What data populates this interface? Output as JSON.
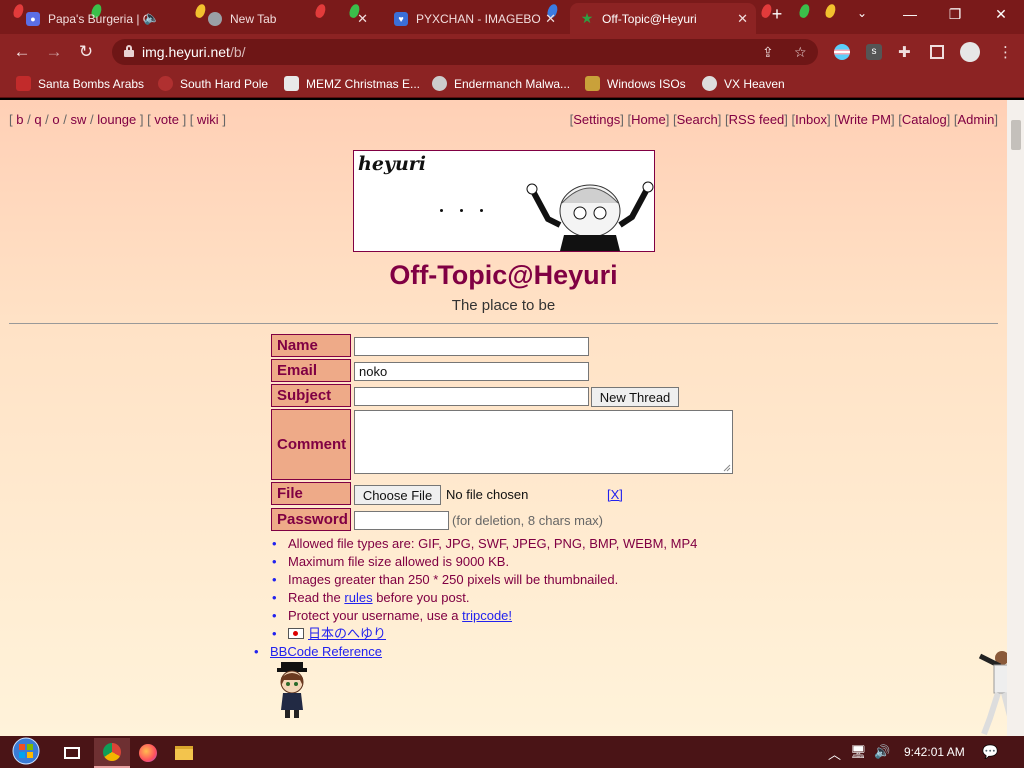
{
  "browser": {
    "tabs": [
      {
        "title": "Papa's Burgeria | C",
        "favicon_color": "#5b6ee6"
      },
      {
        "title": "New Tab",
        "favicon_color": "#9aa0a6"
      },
      {
        "title": "PYXCHAN - IMAGEBO",
        "favicon_color": "#3b6fd8"
      },
      {
        "title": "Off-Topic@Heyuri",
        "favicon_color": "#2ea043",
        "active": true
      }
    ],
    "url_host": "img.heyuri.net",
    "url_path": "/b/",
    "bookmarks": [
      {
        "label": "Santa Bombs Arabs",
        "icon_color": "#c22b2b"
      },
      {
        "label": "South Hard Pole",
        "icon_color": "#b03030"
      },
      {
        "label": "MEMZ Christmas E...",
        "icon_color": "#e8e8e8"
      },
      {
        "label": "Endermanch Malwa...",
        "icon_color": "#cccccc"
      },
      {
        "label": "Windows ISOs",
        "icon_color": "#c9a13a"
      },
      {
        "label": "VX Heaven",
        "icon_color": "#dddddd"
      }
    ]
  },
  "page": {
    "board_nav": {
      "open": "[",
      "items": [
        "b",
        "q",
        "o",
        "sw",
        "lounge"
      ],
      "mid": "] [",
      "vote": "vote",
      "wiki": "wiki",
      "close": "]"
    },
    "top_nav": [
      "Settings",
      "Home",
      "Search",
      "RSS feed",
      "Inbox",
      "Write PM",
      "Catalog",
      "Admin"
    ],
    "banner_text": "heyuri",
    "board_title": "Off-Topic@Heyuri",
    "board_subtitle": "The place to be",
    "form": {
      "name_label": "Name",
      "email_label": "Email",
      "email_value": "noko",
      "subject_label": "Subject",
      "submit_label": "New Thread",
      "comment_label": "Comment",
      "file_label": "File",
      "choose_file_label": "Choose File",
      "no_file_text": "No file chosen",
      "remove_file_label": "[X]",
      "password_label": "Password",
      "password_note": "(for deletion, 8 chars max)"
    },
    "rules": {
      "file_types": "Allowed file types are: GIF, JPG, SWF, JPEG, PNG, BMP, WEBM, MP4",
      "max_size": "Maximum file size allowed is 9000 KB.",
      "thumbnail": "Images greater than 250 * 250 pixels will be thumbnailed.",
      "rules_prefix": "Read the",
      "rules_link": "rules",
      "rules_suffix": "before you post.",
      "tripcode_prefix": "Protect your username, use a",
      "tripcode_link": "tripcode!",
      "japanese_link": "日本のへゆり",
      "bbcode_link": "BBCode Reference"
    }
  },
  "taskbar": {
    "clock": "9:42:01 AM"
  },
  "colors": {
    "accent": "#800043",
    "label_bg": "#eeaa88",
    "link": "#2222ee",
    "chrome_frame": "#8c2323"
  }
}
